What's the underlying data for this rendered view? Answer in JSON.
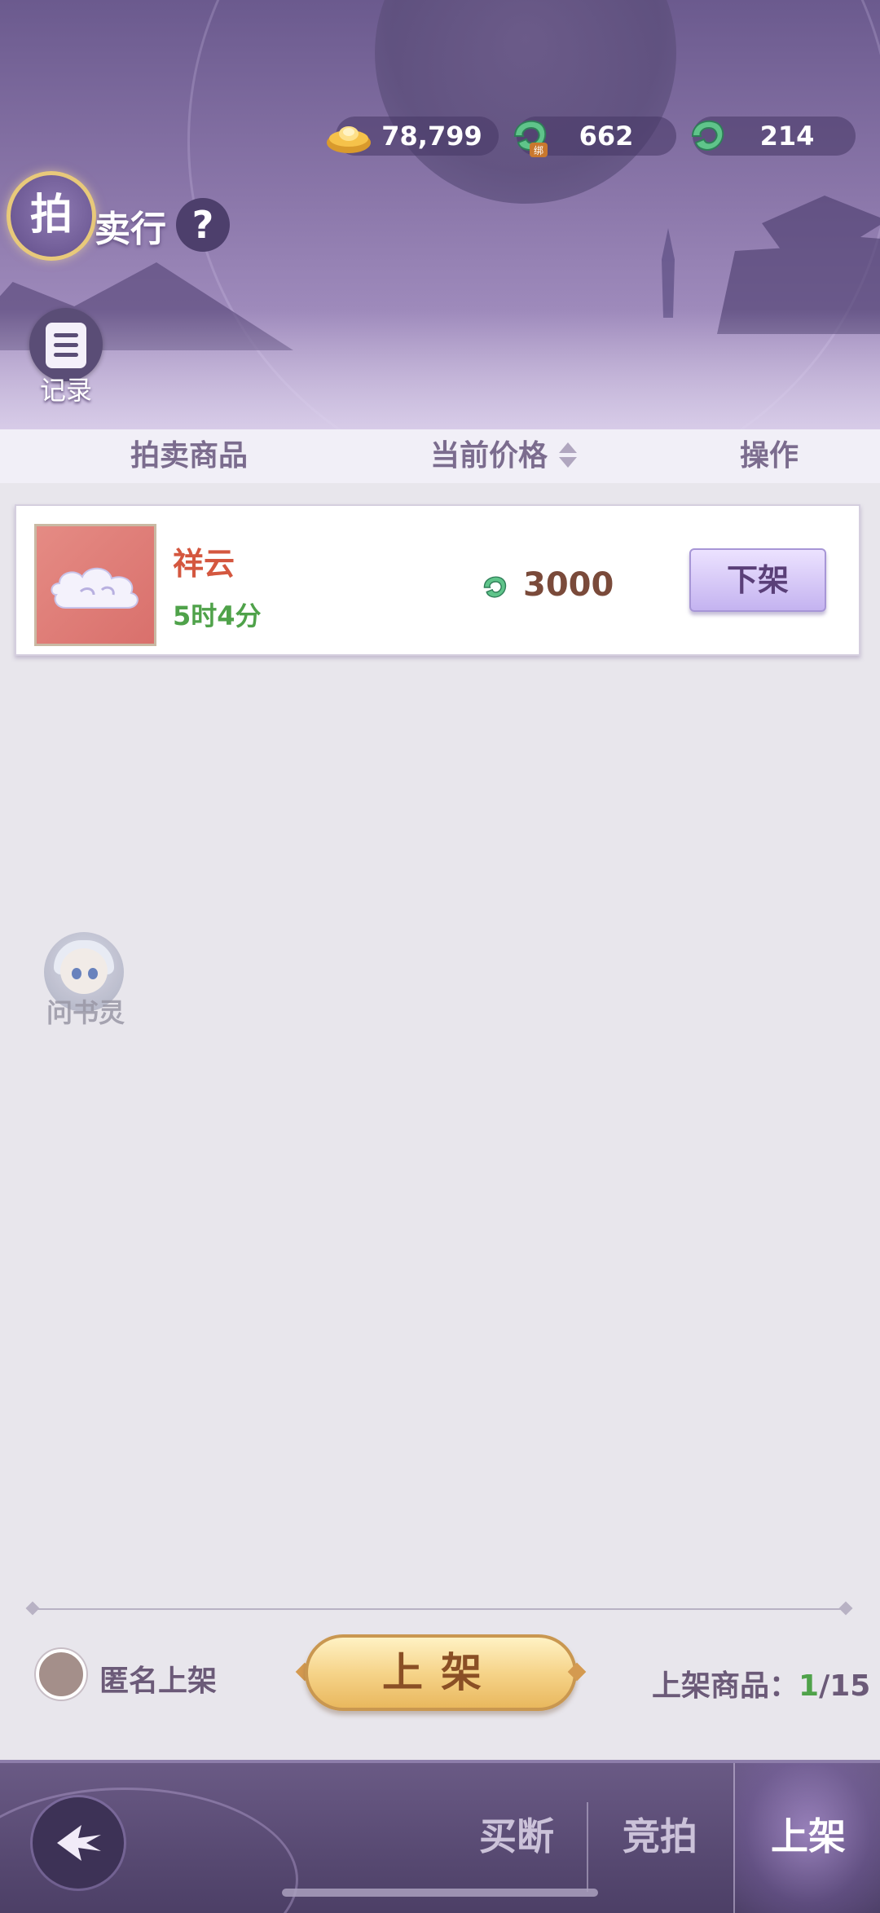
{
  "header": {
    "title_seal": "拍",
    "title_rest": "卖行",
    "help_label": "?",
    "record_label": "记录",
    "currencies": [
      {
        "icon": "gold-ingot-icon",
        "value": "78,799"
      },
      {
        "icon": "bound-jade-icon",
        "value": "662"
      },
      {
        "icon": "jade-icon",
        "value": "214"
      }
    ]
  },
  "table": {
    "columns": [
      "拍卖商品",
      "当前价格",
      "操作"
    ],
    "rows": [
      {
        "name": "祥云",
        "time_left": "5时4分",
        "price": "3000",
        "price_icon": "jade-icon",
        "action_label": "下架"
      }
    ]
  },
  "assistant": {
    "label": "问书灵"
  },
  "footer": {
    "anonymous_label": "匿名上架",
    "list_button_label": "上架",
    "listed_label": "上架商品：",
    "listed_current": "1",
    "listed_max": "/15"
  },
  "nav": {
    "tabs": [
      {
        "label": "买断",
        "active": false
      },
      {
        "label": "竞拍",
        "active": false
      },
      {
        "label": "上架",
        "active": true
      }
    ]
  },
  "colors": {
    "accent_purple": "#8a76a9",
    "item_name": "#d4573f",
    "time_green": "#4fa24a",
    "gold_button": "#f6d48a"
  }
}
